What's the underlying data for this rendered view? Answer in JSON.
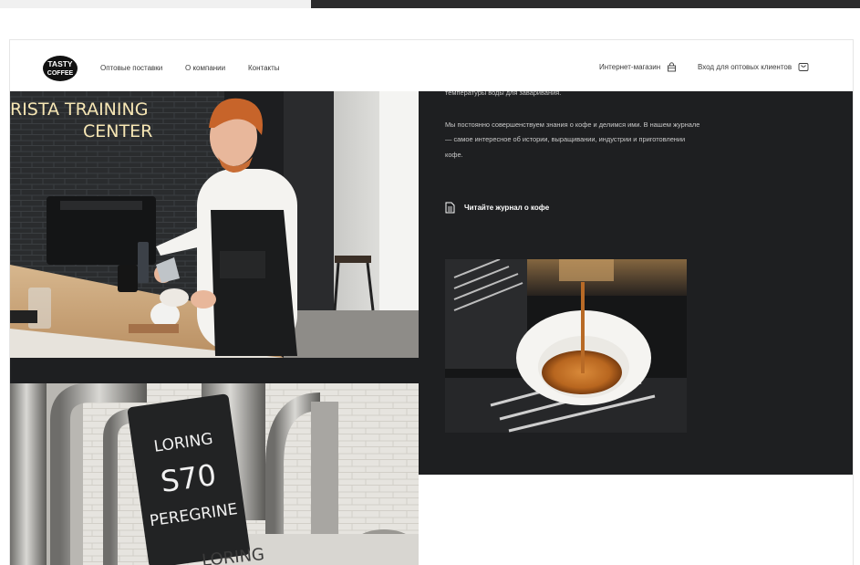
{
  "brand": {
    "logo_top": "TASTY",
    "logo_bottom": "COFFEE"
  },
  "nav": {
    "wholesale": "Оптовые поставки",
    "about": "О компании",
    "contacts": "Контакты",
    "shop": "Интернет-магазин",
    "wholesale_login": "Вход для оптовых клиентов"
  },
  "content": {
    "para_top": "температуры воды для заваривания.",
    "para_main_1": "Мы постоянно совершенствуем знания о кофе и делимся ими. В нашем журнале",
    "para_main_2": "— самое интересное об истории, выращивании, индустрии и приготовлении",
    "para_main_3": "кофе.",
    "journal_link": "Читайте журнал о кофе"
  },
  "photos": {
    "barista_sign_line1": "RISTA TRAINING",
    "barista_sign_line2": "CENTER",
    "roaster_line1": "LORING",
    "roaster_line2": "S70",
    "roaster_line3": "PEREGRINE",
    "roaster_bottom": "LORING"
  },
  "colors": {
    "dark_panel": "#1e1f21",
    "neon": "#f6e6b4",
    "coffee": "#b86a26"
  },
  "icons": {
    "shop": "shop-bag-icon",
    "login": "cart-icon",
    "journal": "document-icon"
  }
}
